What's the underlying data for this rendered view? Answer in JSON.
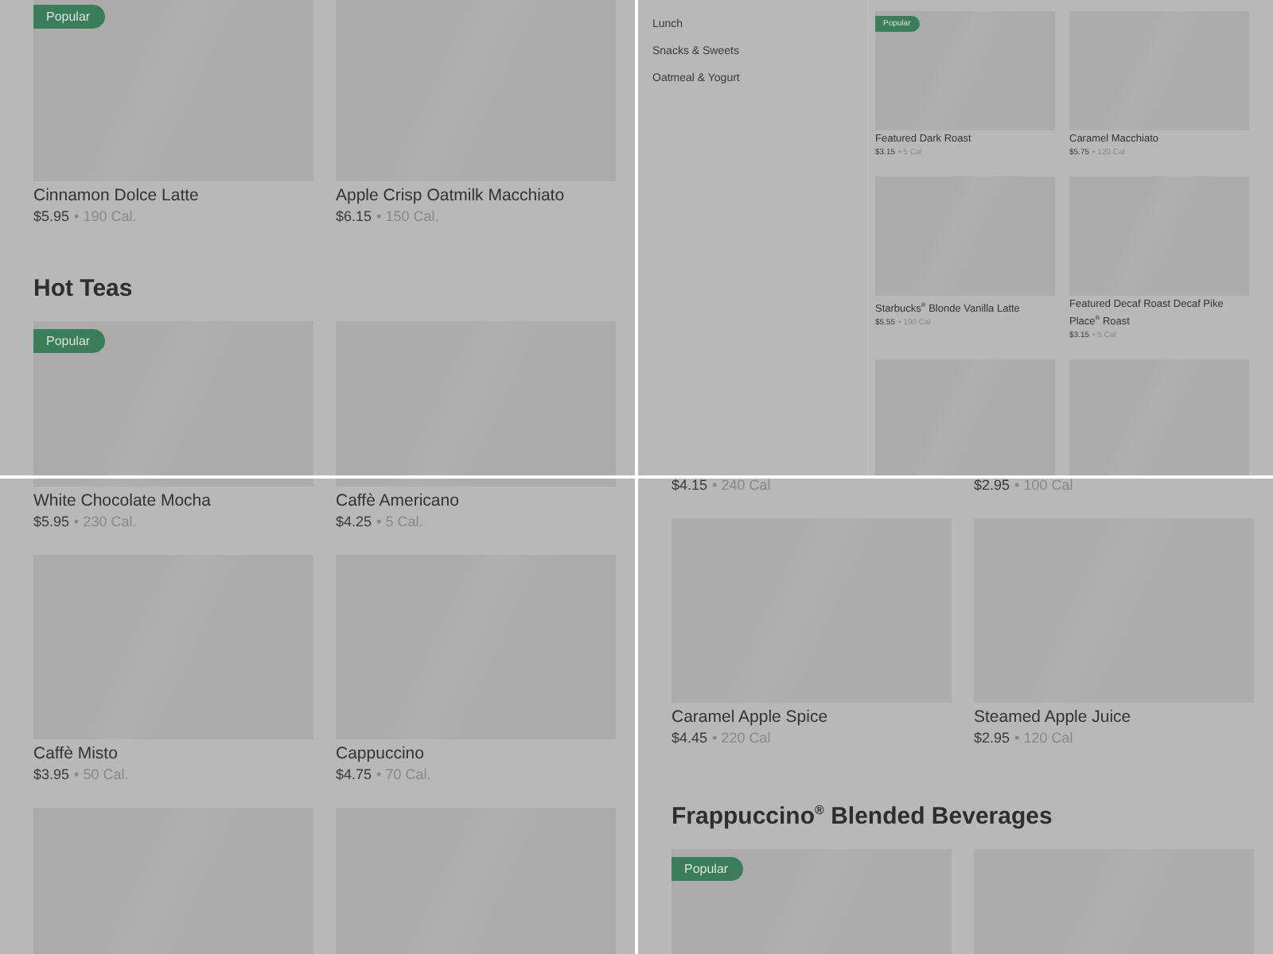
{
  "panels": [
    {
      "kind": "grid",
      "rows": [
        {
          "kind": "cards",
          "cards": [
            {
              "kind": "item",
              "badge": "Popular",
              "name": "Cinnamon Dolce Latte",
              "price": "$5.95",
              "separator": "•",
              "calories": "190 Cal."
            },
            {
              "kind": "item",
              "name": "Apple Crisp Oatmilk Macchiato",
              "price": "$6.15",
              "separator": "•",
              "calories": "150 Cal."
            }
          ]
        },
        {
          "kind": "heading",
          "text": "Hot Teas"
        },
        {
          "kind": "cards",
          "cards": [
            {
              "kind": "item",
              "badge": "Popular"
            },
            {
              "kind": "placeholder"
            }
          ]
        }
      ]
    },
    {
      "kind": "sidebar_grid",
      "sidebar": [
        "Lunch",
        "Snacks & Sweets",
        "Oatmeal & Yogurt"
      ],
      "rows": [
        {
          "kind": "cards",
          "cards": [
            {
              "kind": "item",
              "badge": "Popular",
              "name": "Featured Dark Roast",
              "price": "$3.15",
              "separator": "•",
              "calories": "5 Cal"
            },
            {
              "kind": "item",
              "name": "Caramel Macchiato",
              "price": "$5.75",
              "separator": "•",
              "calories": "120 Cal"
            }
          ]
        },
        {
          "kind": "cards",
          "cards": [
            {
              "kind": "item",
              "name": "Starbucks$^{®}$ Blonde Vanilla Latte",
              "price": "$5.55",
              "separator": "•",
              "calories": "190 Cal"
            },
            {
              "kind": "item",
              "name": "Featured Decaf Roast Decaf Pike Place$^{®}$ Roast",
              "price": "$3.15",
              "separator": "•",
              "calories": "5 Cal"
            }
          ]
        },
        {
          "kind": "cards",
          "cards": [
            {
              "kind": "placeholder"
            },
            {
              "kind": "placeholder"
            }
          ]
        }
      ]
    },
    {
      "kind": "grid",
      "rows": [
        {
          "kind": "cards",
          "cards": [
            {
              "kind": "item",
              "name": "White Chocolate Mocha",
              "price": "$5.95",
              "separator": "•",
              "calories": "230 Cal."
            },
            {
              "kind": "item",
              "name": "Caffè Americano",
              "price": "$4.25",
              "separator": "•",
              "calories": "5 Cal."
            }
          ]
        },
        {
          "kind": "cards",
          "cards": [
            {
              "kind": "item",
              "name": "Caffè Misto",
              "price": "$3.95",
              "separator": "•",
              "calories": "50 Cal."
            },
            {
              "kind": "item",
              "name": "Cappuccino",
              "price": "$4.75",
              "separator": "•",
              "calories": "70 Cal."
            }
          ]
        },
        {
          "kind": "cards",
          "cards": [
            {
              "kind": "placeholder"
            },
            {
              "kind": "placeholder"
            }
          ]
        }
      ]
    },
    {
      "kind": "grid",
      "rows": [
        {
          "kind": "tail",
          "cards": [
            {
              "kind": "item",
              "price": "$4.15",
              "separator": "•",
              "calories": "240 Cal"
            },
            {
              "kind": "item",
              "price": "$2.95",
              "separator": "•",
              "calories": "100 Cal"
            }
          ]
        },
        {
          "kind": "cards",
          "cards": [
            {
              "kind": "item",
              "name": "Caramel Apple Spice",
              "price": "$4.45",
              "separator": "•",
              "calories": "220 Cal"
            },
            {
              "kind": "item",
              "name": "Steamed Apple Juice",
              "price": "$2.95",
              "separator": "•",
              "calories": "120 Cal"
            }
          ]
        },
        {
          "kind": "heading",
          "text": "Frappuccino$^{®}$ Blended Beverages"
        },
        {
          "kind": "cards",
          "cards": [
            {
              "kind": "item",
              "badge": "Popular"
            },
            {
              "kind": "placeholder"
            }
          ]
        }
      ]
    }
  ]
}
